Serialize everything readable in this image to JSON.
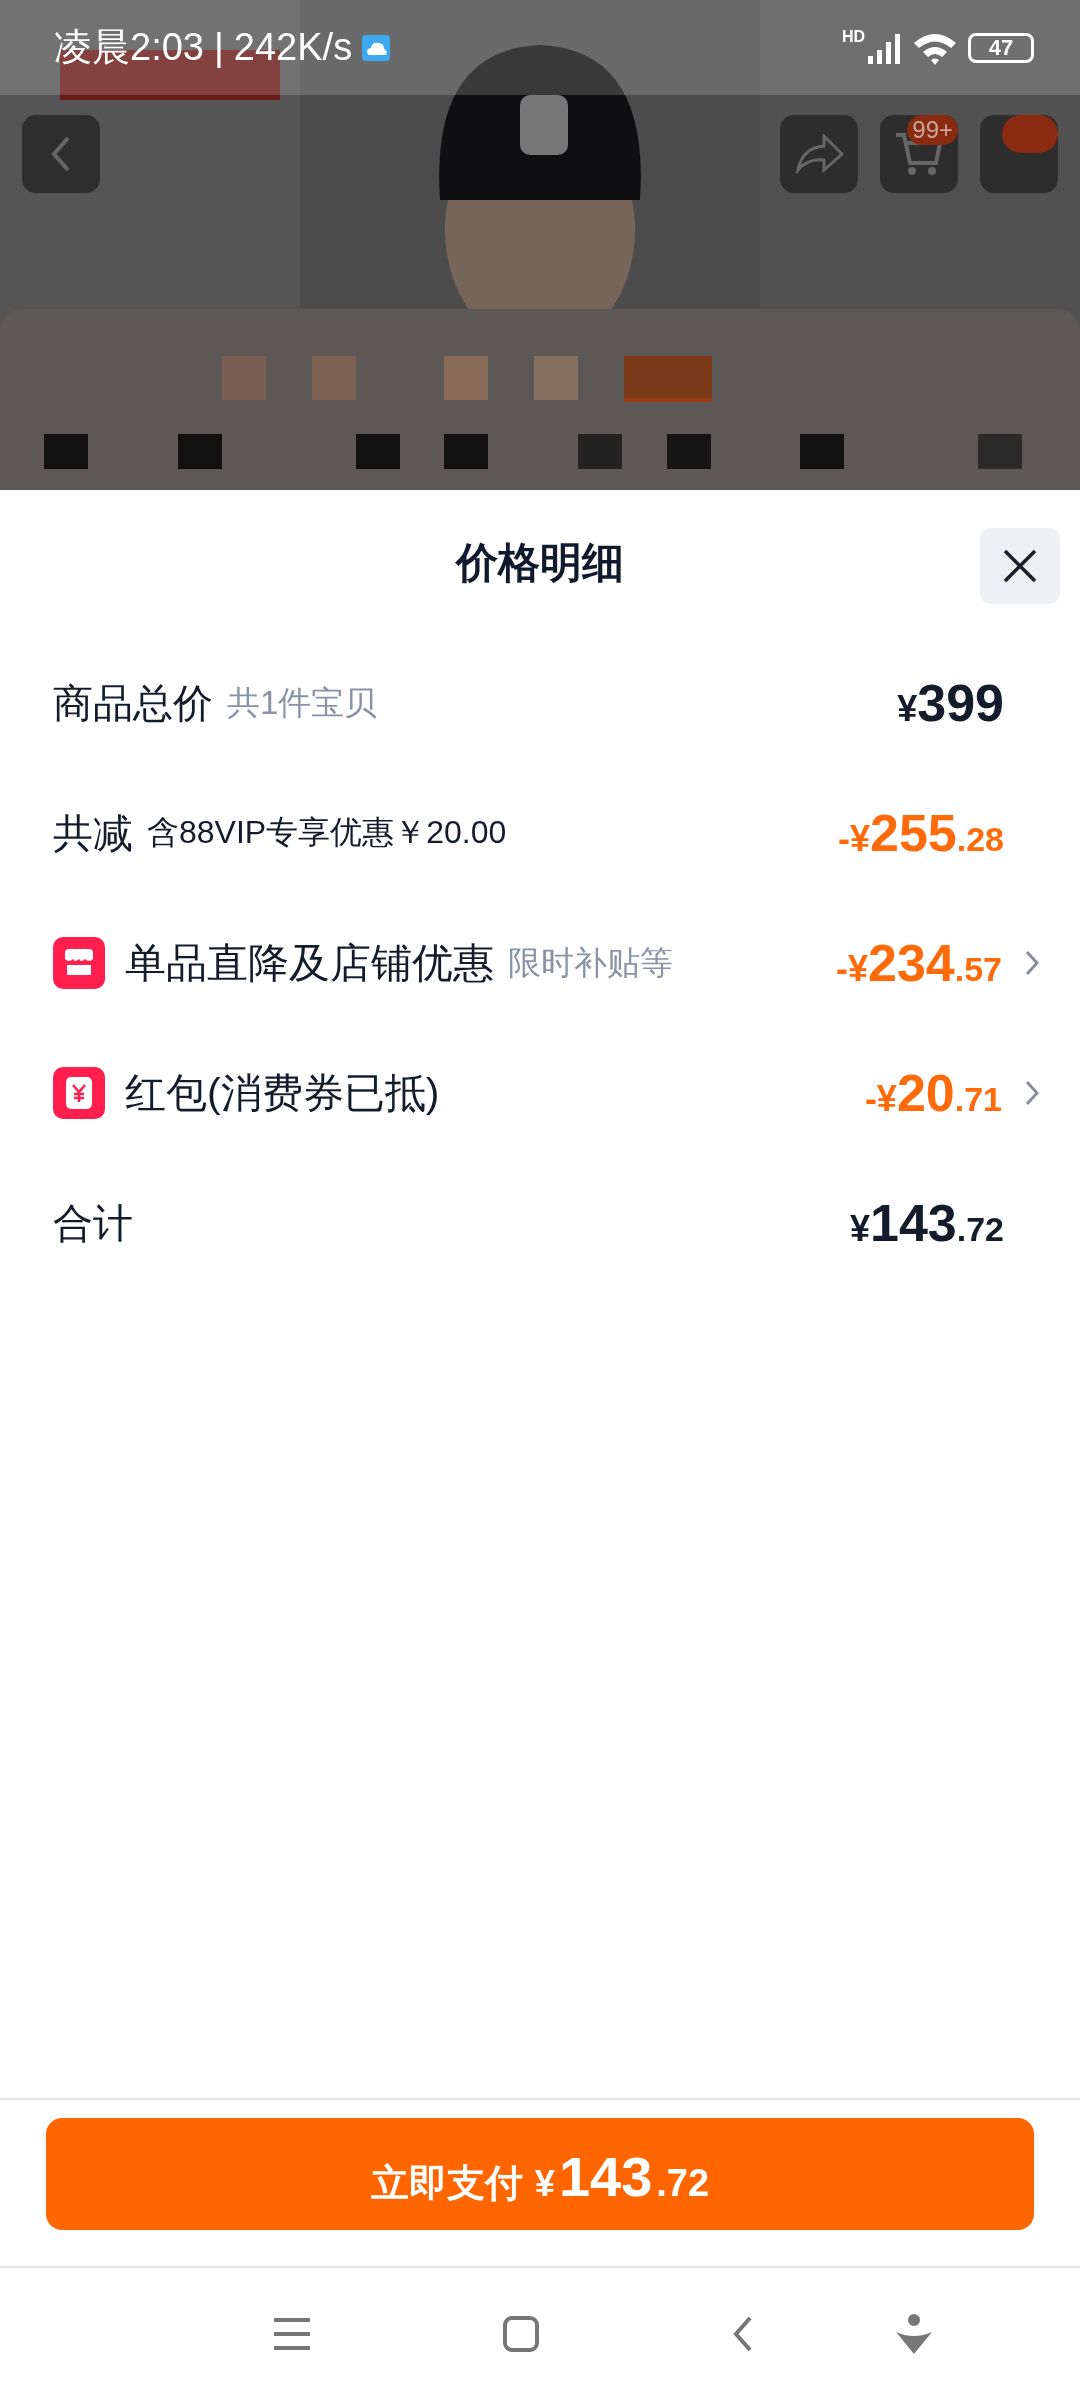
{
  "status_bar": {
    "time": "凌晨2:03",
    "separator": "|",
    "speed": "242K/s",
    "network": "HD",
    "battery": "47"
  },
  "header": {
    "cart_badge": "99+"
  },
  "sheet": {
    "title": "价格明细",
    "rows": [
      {
        "kind": "subtotal",
        "label": "商品总价",
        "note": "共1件宝贝",
        "price": {
          "prefix": "¥",
          "integer": "399"
        }
      },
      {
        "kind": "reduction",
        "label": "共减",
        "note": "含88VIP专享优惠￥20.00",
        "price": {
          "prefix": "-¥",
          "integer": "255",
          "decimal": ".28"
        }
      },
      {
        "kind": "store_discount",
        "label": "单品直降及店铺优惠",
        "note": "限时补贴等",
        "price": {
          "prefix": "-¥",
          "integer": "234",
          "decimal": ".57"
        }
      },
      {
        "kind": "coupon",
        "label": "红包(消费券已抵)",
        "price": {
          "prefix": "-¥",
          "integer": "20",
          "decimal": ".71"
        }
      },
      {
        "kind": "total",
        "label": "合计",
        "price": {
          "prefix": "¥",
          "integer": "143",
          "decimal": ".72"
        }
      }
    ]
  },
  "pay_button": {
    "label": "立即支付",
    "price": {
      "prefix": "¥",
      "integer": "143",
      "decimal": ".72"
    }
  }
}
